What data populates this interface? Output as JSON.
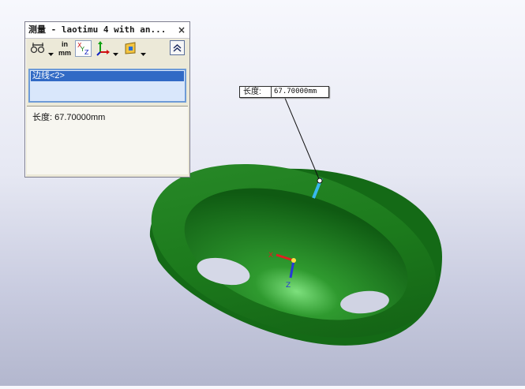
{
  "panel": {
    "title": "测量 - laotimu 4 with an...",
    "close_glyph": "×",
    "units_top": "in",
    "units_bottom": "mm",
    "selection_items": [
      "边线<2>"
    ],
    "result_label": "长度: 67.70000mm"
  },
  "callout": {
    "label": "长度:",
    "value": "67.70000mm"
  },
  "triad": {
    "x_label": "X",
    "z_label": "Z"
  },
  "icons": [
    "measure-arc-icon",
    "units-icon",
    "xyz-icon",
    "coordinate-system-icon",
    "projection-plane-icon",
    "collapse-icon",
    "close-icon"
  ],
  "colors": {
    "part_green": "#1f7d1f",
    "edge_highlight": "#38b8ee",
    "selection_blue": "#316ac5"
  }
}
